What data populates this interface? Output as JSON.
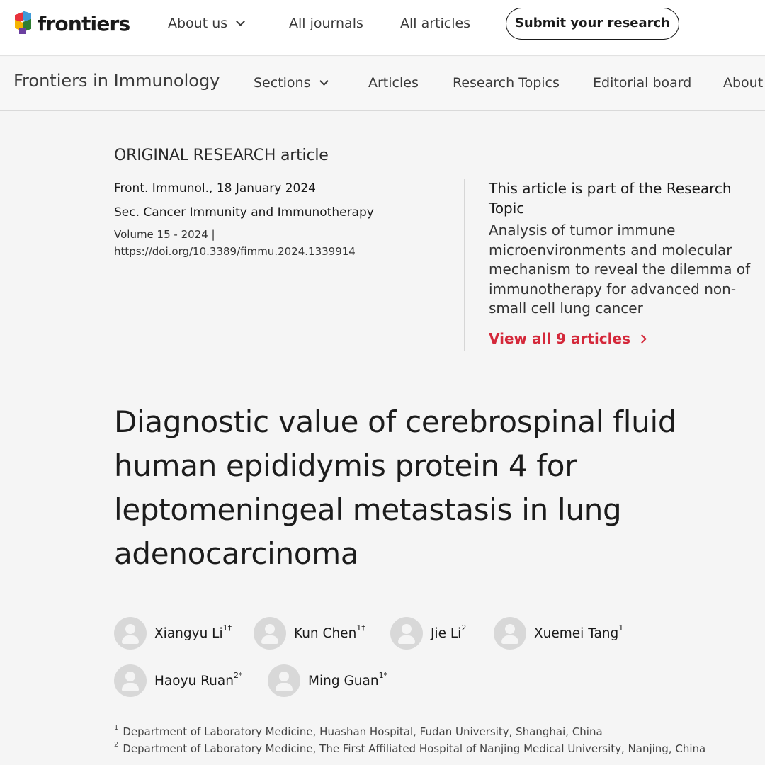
{
  "topbar": {
    "brand": "frontiers",
    "nav": [
      "About us",
      "All journals",
      "All articles"
    ],
    "submit_label": "Submit your research"
  },
  "journalbar": {
    "title": "Frontiers in Immunology",
    "nav": [
      "Sections",
      "Articles",
      "Research Topics",
      "Editorial board",
      "About"
    ]
  },
  "article": {
    "type": "ORIGINAL RESEARCH article",
    "journal_date": "Front. Immunol., 18 January 2024",
    "section": "Sec. Cancer Immunity and Immunotherapy",
    "volume": "Volume 15 - 2024 |",
    "doi": "https://doi.org/10.3389/fimmu.2024.1339914",
    "title": "Diagnostic value of cerebrospinal fluid human epididymis protein 4 for leptomeningeal metastasis in lung adenocarcinoma"
  },
  "research_topic": {
    "heading": "This article is part of the Research Topic",
    "title": "Analysis of tumor immune microenvironments and molecular mechanism to reveal the dilemma of immunotherapy for advanced non-small cell lung cancer",
    "view_all": "View all 9 articles"
  },
  "authors": [
    {
      "name": "Xiangyu Li",
      "sup": "1†"
    },
    {
      "name": "Kun Chen",
      "sup": "1†"
    },
    {
      "name": "Jie Li",
      "sup": "2"
    },
    {
      "name": "Xuemei Tang",
      "sup": "1"
    },
    {
      "name": "Haoyu Ruan",
      "sup": "2*"
    },
    {
      "name": "Ming Guan",
      "sup": "1*"
    }
  ],
  "affiliations": [
    {
      "num": "1",
      "text": "Department of Laboratory Medicine, Huashan Hospital, Fudan University, Shanghai, China"
    },
    {
      "num": "2",
      "text": "Department of Laboratory Medicine, The First Affiliated Hospital of Nanjing Medical University, Nanjing, China"
    }
  ],
  "colors": {
    "accent_red": "#d4283a"
  },
  "icons": [
    "frontiers-logo-icon",
    "chevron-down-icon",
    "chevron-right-icon",
    "avatar-placeholder-icon"
  ]
}
